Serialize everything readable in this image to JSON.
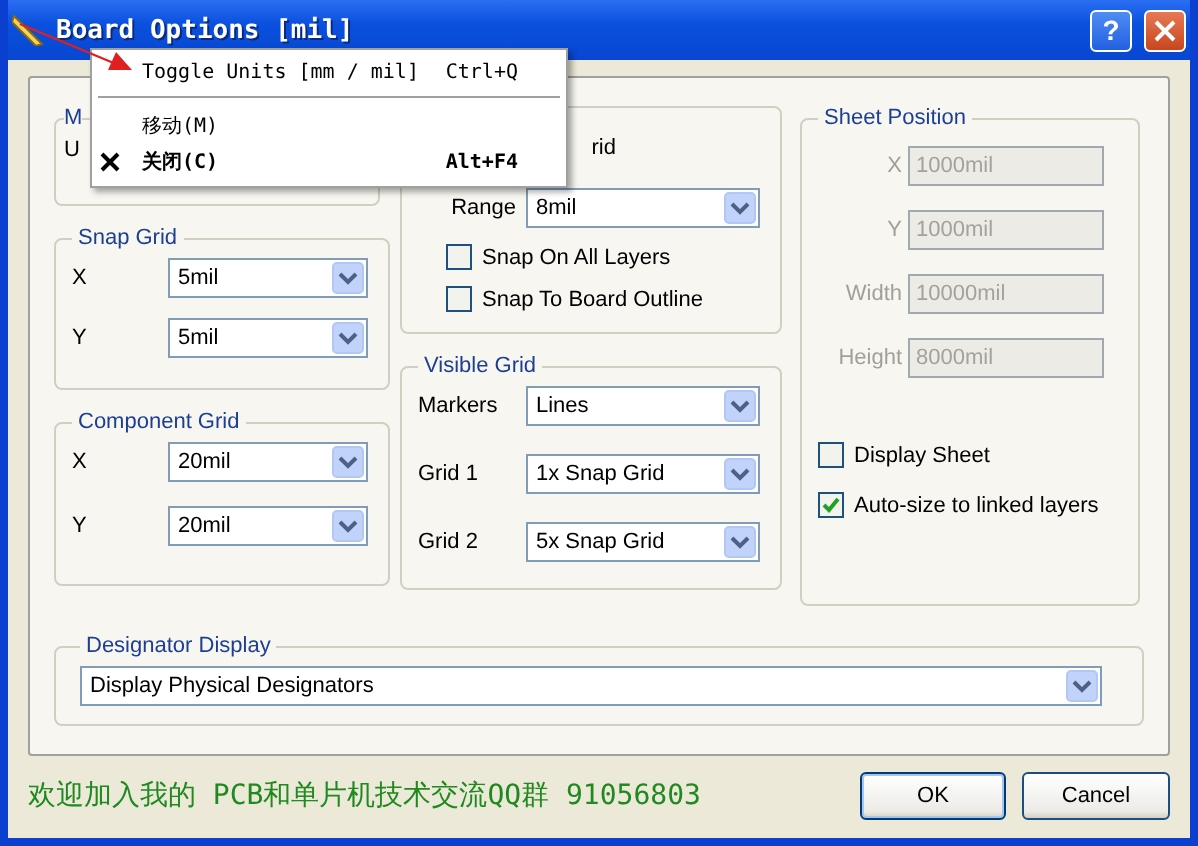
{
  "window": {
    "title": "Board Options [mil]",
    "help_button": "?"
  },
  "menu": {
    "items": [
      {
        "kind": "command",
        "label": "Toggle Units [mm / mil]",
        "shortcut": "Ctrl+Q"
      },
      {
        "kind": "separator"
      },
      {
        "kind": "command",
        "label": "移动(M)"
      },
      {
        "kind": "close",
        "label": "关闭(C)",
        "shortcut": "Alt+F4"
      }
    ]
  },
  "measurement_units": {
    "title": "M",
    "label": "U"
  },
  "snap_grid": {
    "title": "Snap Grid",
    "fields": [
      {
        "label": "X",
        "value": "5mil"
      },
      {
        "label": "Y",
        "value": "5mil"
      }
    ]
  },
  "component_grid": {
    "title": "Component Grid",
    "fields": [
      {
        "label": "X",
        "value": "20mil"
      },
      {
        "label": "Y",
        "value": "20mil"
      }
    ]
  },
  "electrical_grid": {
    "label": "rid",
    "range_label": "Range",
    "range": "8mil",
    "options": [
      {
        "label": "Snap On All Layers",
        "checked": false
      },
      {
        "label": "Snap To Board Outline",
        "checked": false
      }
    ]
  },
  "visible_grid": {
    "title": "Visible Grid",
    "fields": [
      {
        "label": "Markers",
        "value": "Lines"
      },
      {
        "label": "Grid 1",
        "value": "1x Snap Grid"
      },
      {
        "label": "Grid 2",
        "value": "5x Snap Grid"
      }
    ]
  },
  "sheet_position": {
    "title": "Sheet Position",
    "fields": [
      {
        "label": "X",
        "value": "1000mil",
        "disabled": true
      },
      {
        "label": "Y",
        "value": "1000mil",
        "disabled": true
      },
      {
        "label": "Width",
        "value": "10000mil",
        "disabled": true
      },
      {
        "label": "Height",
        "value": "8000mil",
        "disabled": true
      }
    ],
    "options": [
      {
        "label": "Display Sheet",
        "checked": false
      },
      {
        "label": "Auto-size to linked layers",
        "checked": true
      }
    ]
  },
  "designator_display": {
    "title": "Designator Display",
    "value": "Display Physical Designators"
  },
  "footer_note": "欢迎加入我的 PCB和单片机技术交流QQ群 91056803",
  "buttons": [
    {
      "label": "OK",
      "default": true
    },
    {
      "label": "Cancel",
      "default": false
    }
  ]
}
